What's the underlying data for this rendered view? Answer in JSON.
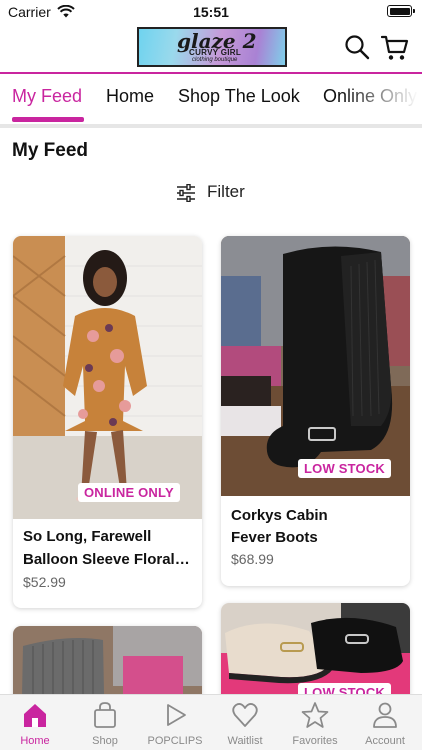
{
  "status_bar": {
    "carrier": "Carrier",
    "time": "15:51"
  },
  "header": {
    "logo": {
      "brand": "glaze 2",
      "line1": "CURVY GIRL",
      "line2": "clothing boutique"
    },
    "search_icon": "search-icon",
    "cart_icon": "cart-icon"
  },
  "colors": {
    "accent": "#c9259f",
    "text": "#111111",
    "muted": "#8a8a8a"
  },
  "tabs": [
    {
      "label": "My Feed",
      "active": true
    },
    {
      "label": "Home",
      "active": false
    },
    {
      "label": "Shop The Look",
      "active": false
    },
    {
      "label": "Online Only",
      "active": false
    }
  ],
  "feed": {
    "title": "My Feed",
    "filter_label": "Filter",
    "products": [
      {
        "name_line1": "So Long, Farewell",
        "name_line2": "Balloon Sleeve Floral…",
        "price": "$52.99",
        "badge": "ONLINE ONLY"
      },
      {
        "name_line1": "Corkys Cabin",
        "name_line2": "Fever Boots",
        "price": "$68.99",
        "badge": "LOW STOCK"
      },
      {
        "badge": ""
      },
      {
        "badge": "LOW STOCK"
      }
    ]
  },
  "tabbar": [
    {
      "label": "Home",
      "icon": "home-icon",
      "active": true
    },
    {
      "label": "Shop",
      "icon": "shopping-bag-icon",
      "active": false
    },
    {
      "label": "POPCLIPS",
      "icon": "play-icon",
      "active": false
    },
    {
      "label": "Waitlist",
      "icon": "heart-icon",
      "active": false
    },
    {
      "label": "Favorites",
      "icon": "star-icon",
      "active": false
    },
    {
      "label": "Account",
      "icon": "person-icon",
      "active": false
    }
  ]
}
